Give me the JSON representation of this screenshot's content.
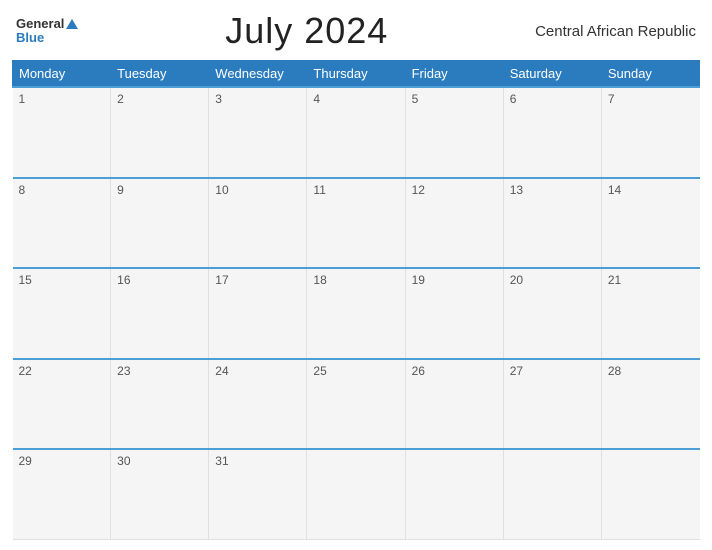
{
  "header": {
    "logo": {
      "general": "General",
      "blue": "Blue",
      "triangle": true
    },
    "title": "July 2024",
    "country": "Central African Republic"
  },
  "calendar": {
    "days_of_week": [
      "Monday",
      "Tuesday",
      "Wednesday",
      "Thursday",
      "Friday",
      "Saturday",
      "Sunday"
    ],
    "weeks": [
      [
        "1",
        "2",
        "3",
        "4",
        "5",
        "6",
        "7"
      ],
      [
        "8",
        "9",
        "10",
        "11",
        "12",
        "13",
        "14"
      ],
      [
        "15",
        "16",
        "17",
        "18",
        "19",
        "20",
        "21"
      ],
      [
        "22",
        "23",
        "24",
        "25",
        "26",
        "27",
        "28"
      ],
      [
        "29",
        "30",
        "31",
        "",
        "",
        "",
        ""
      ]
    ]
  }
}
